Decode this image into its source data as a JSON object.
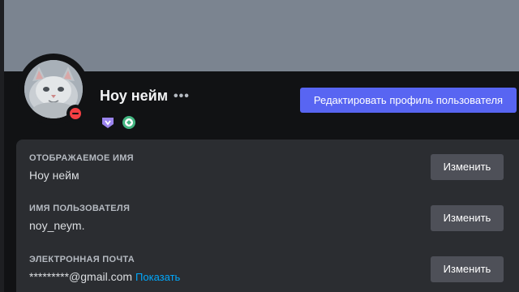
{
  "profile": {
    "display_name": "Ноу нейм",
    "more_label": "•••",
    "avatar_icon": "cat-avatar",
    "status": "do-not-disturb",
    "badges": [
      "hypesquad-badge-icon",
      "nitro-badge-icon"
    ],
    "edit_button_label": "Редактировать профиль пользователя"
  },
  "fields": [
    {
      "label": "ОТОБРАЖАЕМОЕ ИМЯ",
      "value": "Ноу нейм",
      "button": "Изменить"
    },
    {
      "label": "ИМЯ ПОЛЬЗОВАТЕЛЯ",
      "value": "noy_neym.",
      "button": "Изменить"
    },
    {
      "label": "ЭЛЕКТРОННАЯ ПОЧТА",
      "value": "*********@gmail.com",
      "reveal_link": "Показать",
      "button": "Изменить"
    }
  ],
  "colors": {
    "banner": "#7b8490",
    "accent": "#5865f2",
    "status_dnd": "#f23f43",
    "link": "#00a8fc"
  }
}
